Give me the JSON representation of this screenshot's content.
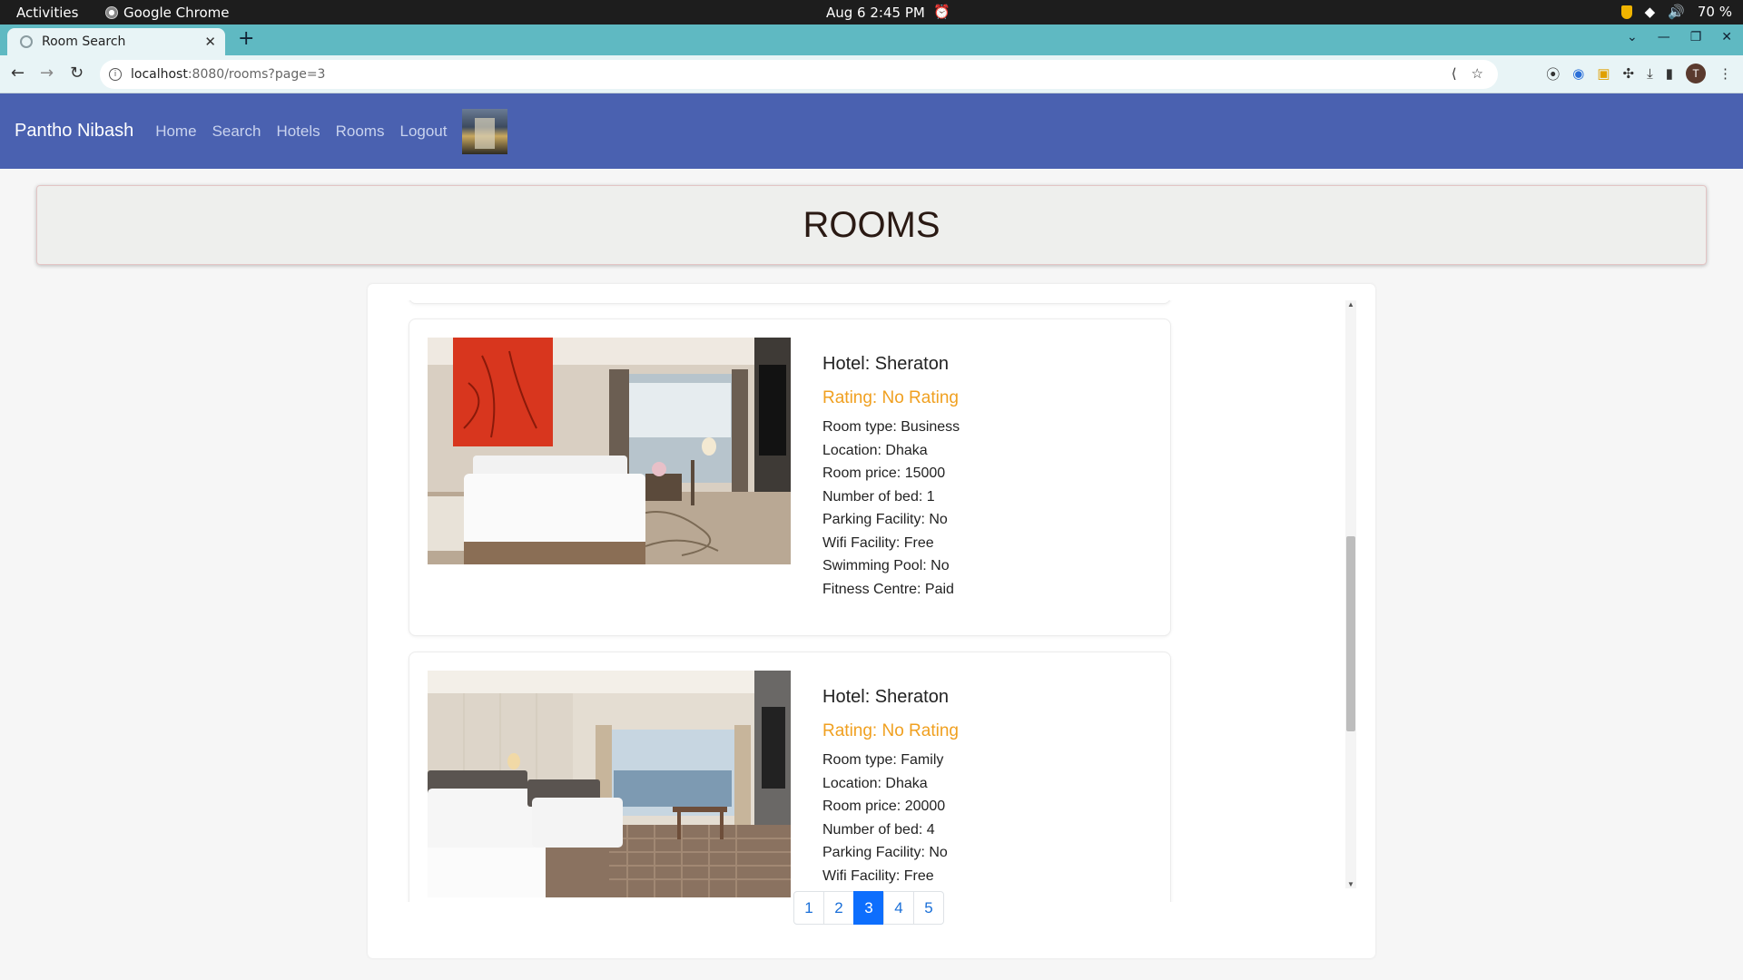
{
  "os": {
    "activities": "Activities",
    "app_name": "Google Chrome",
    "clock": "Aug 6  2:45 PM",
    "battery": "70 %"
  },
  "browser": {
    "tab_title": "Room Search",
    "url_host": "localhost",
    "url_path": ":8080/rooms?page=3"
  },
  "navbar": {
    "brand": "Pantho Nibash",
    "links": [
      "Home",
      "Search",
      "Hotels",
      "Rooms",
      "Logout"
    ]
  },
  "page": {
    "heading": "ROOMS"
  },
  "rooms": [
    {
      "hotel": "Hotel: Sheraton",
      "rating": "Rating: No Rating",
      "room_type": "Room type: Business",
      "location": "Location: Dhaka",
      "price": "Room price: 15000",
      "beds": "Number of bed: 1",
      "parking": "Parking Facility: No",
      "wifi": "Wifi Facility: Free",
      "pool": "Swimming Pool: No",
      "fitness": "Fitness Centre: Paid"
    },
    {
      "hotel": "Hotel: Sheraton",
      "rating": "Rating: No Rating",
      "room_type": "Room type: Family",
      "location": "Location: Dhaka",
      "price": "Room price: 20000",
      "beds": "Number of bed: 4",
      "parking": "Parking Facility: No",
      "wifi": "Wifi Facility: Free"
    }
  ],
  "pagination": {
    "pages": [
      "1",
      "2",
      "3",
      "4",
      "5"
    ],
    "current": "3"
  },
  "colors": {
    "navbar": "#4a61b0",
    "rating": "#f0a020",
    "active_page": "#0d6efd",
    "tabstrip": "#5fb9c2"
  }
}
